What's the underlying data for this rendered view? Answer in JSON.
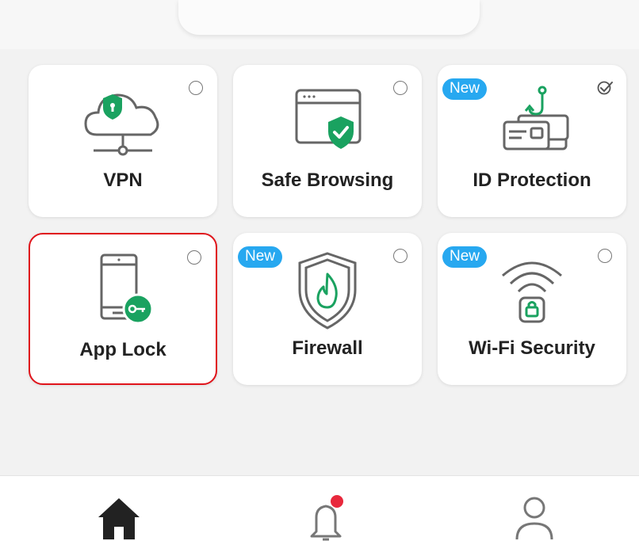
{
  "tiles": [
    {
      "label": "VPN",
      "icon": "vpn-cloud-icon",
      "badge": "",
      "state": "unchecked"
    },
    {
      "label": "Safe Browsing",
      "icon": "safe-browsing-icon",
      "badge": "",
      "state": "unchecked"
    },
    {
      "label": "ID Protection",
      "icon": "id-protection-icon",
      "badge": "New",
      "state": "checked"
    },
    {
      "label": "App Lock",
      "icon": "app-lock-icon",
      "badge": "",
      "state": "unchecked",
      "selected": true
    },
    {
      "label": "Firewall",
      "icon": "firewall-icon",
      "badge": "New",
      "state": "unchecked"
    },
    {
      "label": "Wi-Fi Security",
      "icon": "wifi-security-icon",
      "badge": "New",
      "state": "unchecked"
    }
  ],
  "bottom_nav": {
    "items": [
      {
        "name": "home",
        "icon": "home-icon",
        "active": true
      },
      {
        "name": "notifications",
        "icon": "bell-icon",
        "has_unread_dot": true
      },
      {
        "name": "profile",
        "icon": "user-icon"
      }
    ]
  },
  "colors": {
    "accent_green": "#1aa260",
    "badge_blue": "#27a8f0",
    "selected_border": "#e0141b",
    "notification_dot": "#e8283c"
  }
}
